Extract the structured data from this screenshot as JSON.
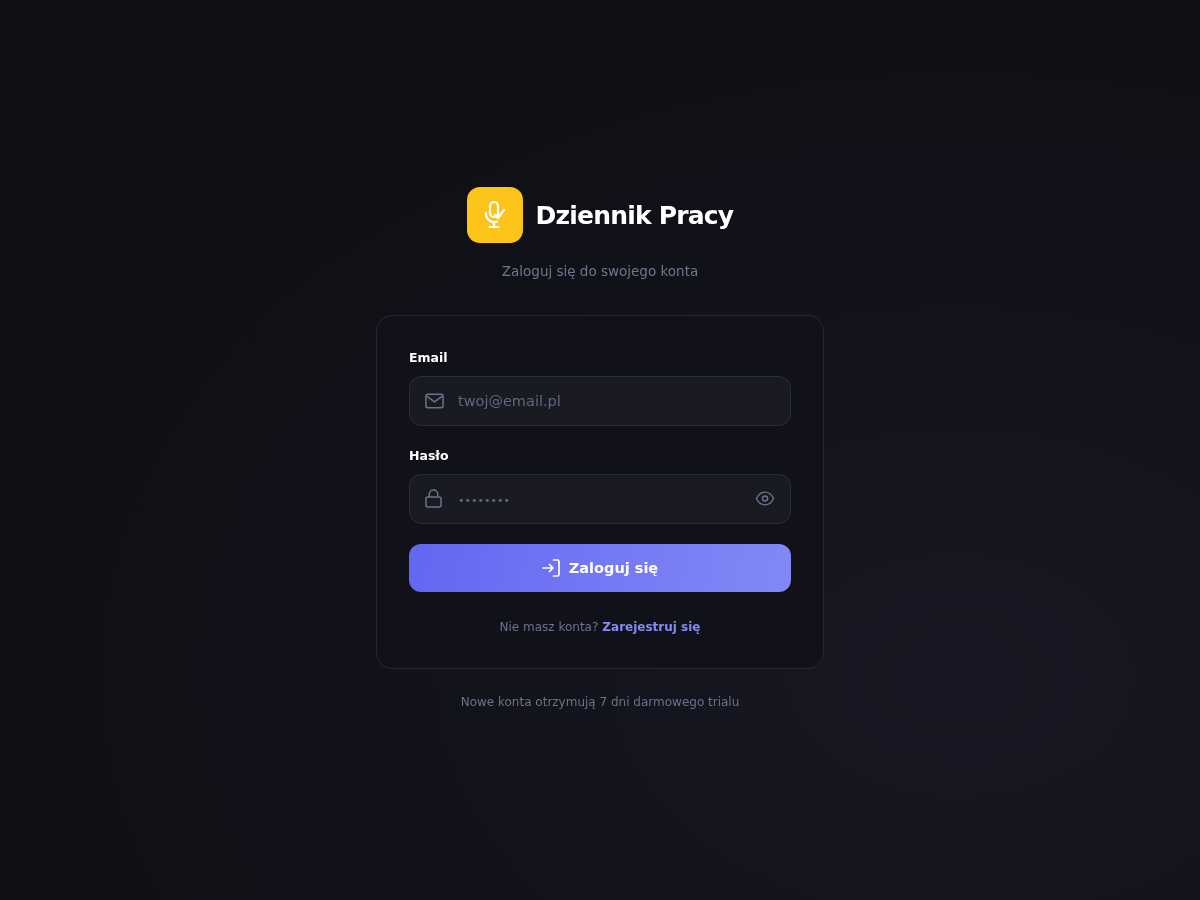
{
  "brand": {
    "title": "Dziennik Pracy"
  },
  "subtitle": "Zaloguj się do swojego konta",
  "form": {
    "fields": [
      {
        "kind": "email",
        "label": "Email",
        "placeholder": "twoj@email.pl"
      },
      {
        "kind": "password",
        "label": "Hasło",
        "placeholder": "••••••••"
      }
    ],
    "submit": "Zaloguj się",
    "signup": {
      "prompt": "Nie masz konta?",
      "link": "Zarejestruj się"
    }
  },
  "footer_note": "Nowe konta otrzymują 7 dni darmowego trialu"
}
